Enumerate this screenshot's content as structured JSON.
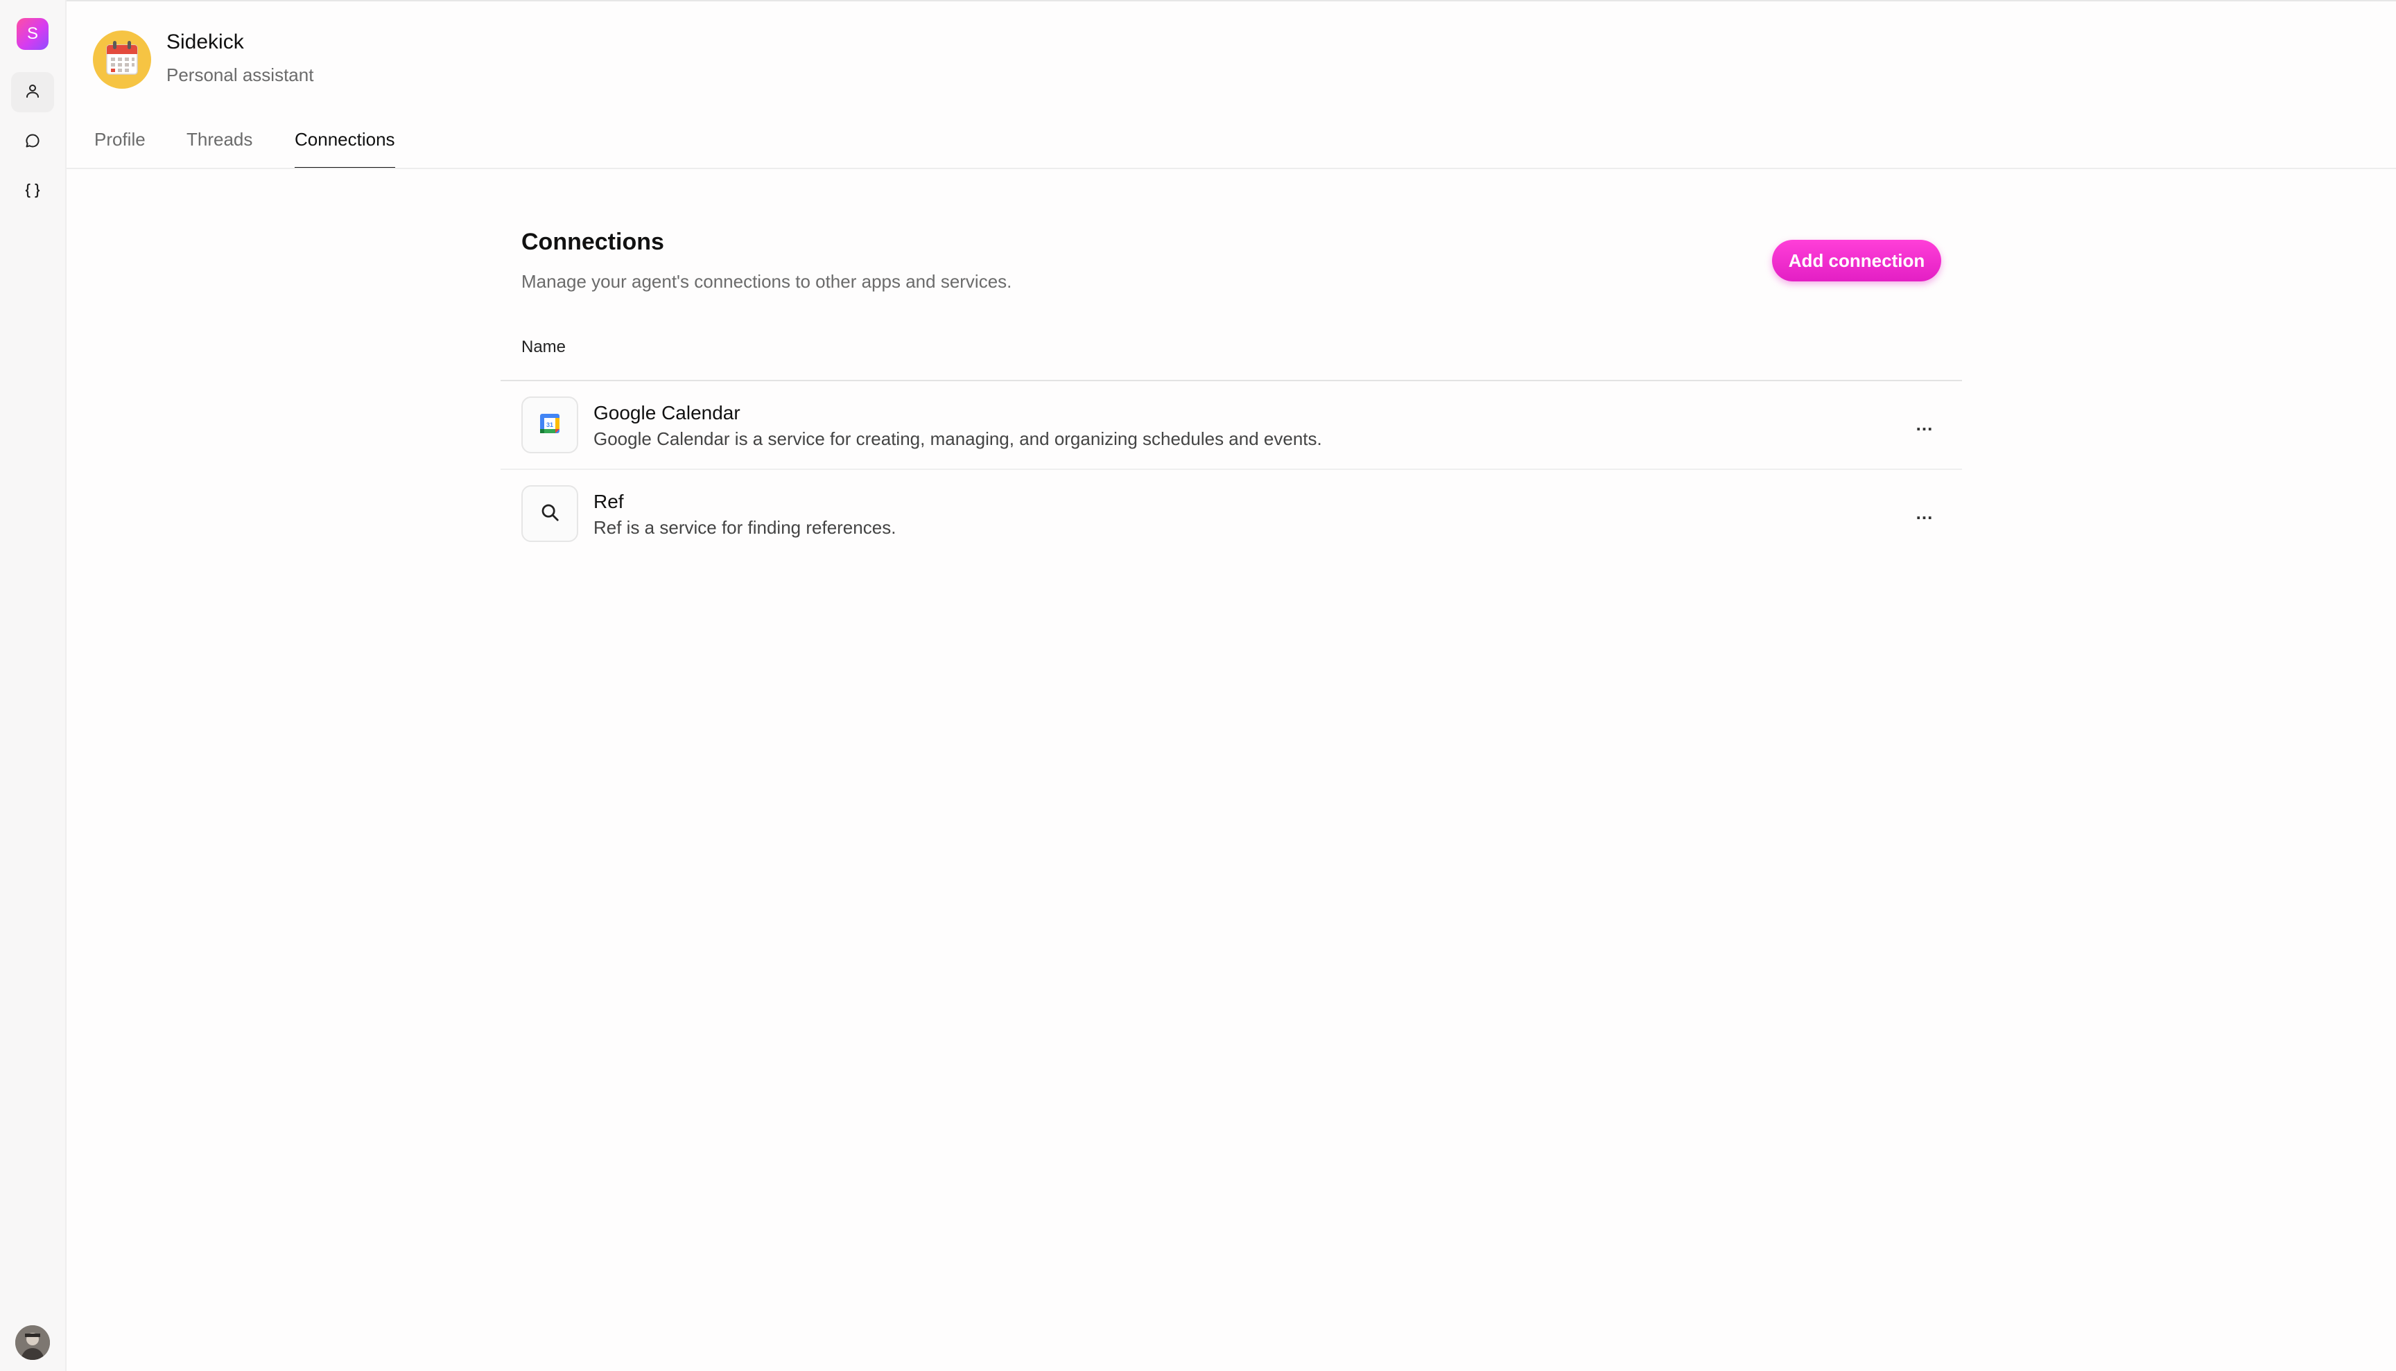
{
  "app": {
    "logo_letter": "S"
  },
  "rail": {
    "items": [
      {
        "name": "profile",
        "icon": "user-icon",
        "active": true
      },
      {
        "name": "threads",
        "icon": "chat-bubble-icon",
        "active": false
      },
      {
        "name": "code",
        "icon": "braces-icon",
        "active": false
      }
    ]
  },
  "agent": {
    "name": "Sidekick",
    "subtitle": "Personal assistant",
    "icon": "calendar-emoji-icon"
  },
  "tabs": [
    {
      "label": "Profile",
      "active": false
    },
    {
      "label": "Threads",
      "active": false
    },
    {
      "label": "Connections",
      "active": true
    }
  ],
  "connections": {
    "title": "Connections",
    "subtitle": "Manage your agent's connections to other apps and services.",
    "add_button_label": "Add connection",
    "column_header": "Name",
    "rows": [
      {
        "name": "Google Calendar",
        "description": "Google Calendar is a service for creating, managing, and organizing schedules and events.",
        "icon": "google-calendar-icon",
        "more": "..."
      },
      {
        "name": "Ref",
        "description": "Ref is a service for finding references.",
        "icon": "search-icon",
        "more": "..."
      }
    ]
  },
  "colors": {
    "accent": "#e31fc4",
    "text_primary": "#111111",
    "text_secondary": "#6b6b6b"
  }
}
